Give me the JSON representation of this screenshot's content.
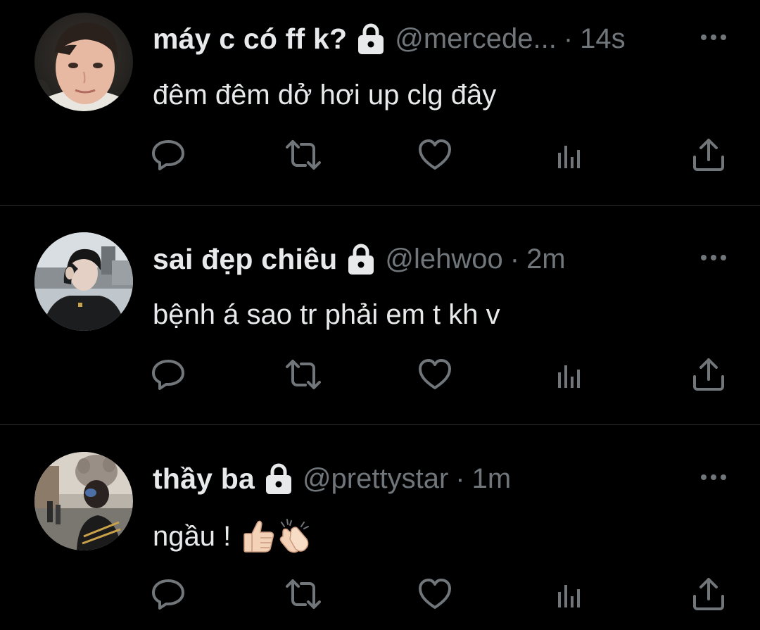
{
  "colors": {
    "background": "#000000",
    "primary_text": "#e7e9ea",
    "secondary_text": "#71767b",
    "divider": "#2f3336"
  },
  "tweets": [
    {
      "display_name": "máy c có ff k?",
      "handle": "@mercede...",
      "separator": "·",
      "time": "14s",
      "text": "đêm đêm dở hơi up clg đây",
      "protected_icon": "lock-icon"
    },
    {
      "display_name": "sai đẹp chiêu",
      "handle": "@lehwoo",
      "separator": "·",
      "time": "2m",
      "text": "bệnh á sao tr phải em t kh v",
      "protected_icon": "lock-icon"
    },
    {
      "display_name": "thầy ba",
      "handle": "@prettystar",
      "separator": "·",
      "time": "1m",
      "text": "ngầu !",
      "emojis": [
        "thumbs-up-emoji",
        "clapping-hands-emoji"
      ],
      "protected_icon": "lock-icon"
    }
  ],
  "actions": [
    "reply-icon",
    "retweet-icon",
    "like-icon",
    "views-icon",
    "share-icon"
  ]
}
